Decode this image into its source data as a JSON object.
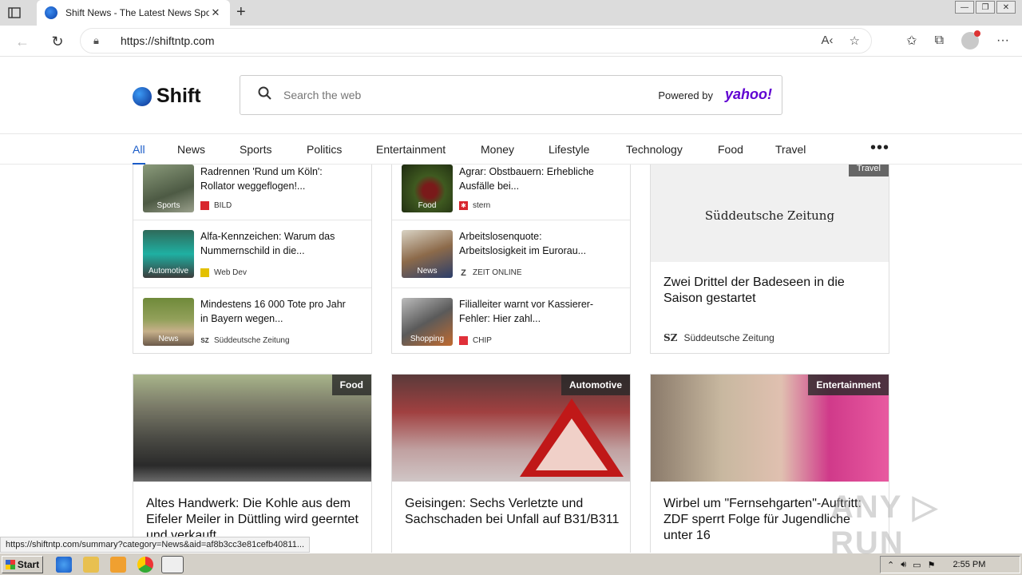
{
  "browser": {
    "tab_title": "Shift News - The Latest News Spo",
    "tab_close": "✕",
    "new_tab": "+",
    "url": "https://shiftntp.com",
    "window_buttons": [
      "—",
      "❐",
      "✕"
    ]
  },
  "site": {
    "logo": "Shift",
    "search_placeholder": "Search the web",
    "powered_by": "Powered by",
    "yahoo": "yahoo!"
  },
  "nav": {
    "items": [
      "All",
      "News",
      "Sports",
      "Politics",
      "Entertainment",
      "Money",
      "Lifestyle",
      "Technology",
      "Food",
      "Travel"
    ],
    "more": "•••"
  },
  "lists": [
    [
      {
        "title": "Radrennen 'Rund um Köln': Rollator weggeflogen!...",
        "category": "Sports",
        "source": "BILD",
        "source_color": "#d8262d",
        "thumb": "#6b7b62"
      },
      {
        "title": "Alfa-Kennzeichen: Warum das Nummernschild in die...",
        "category": "Automotive",
        "source": "Web Dev",
        "source_color": "#e3c000",
        "thumb": "#2aa39a"
      },
      {
        "title": "Mindestens 16 000 Tote pro Jahr in Bayern wegen...",
        "category": "News",
        "source": "Süddeutsche Zeitung",
        "source_color": "#333",
        "thumb": "#7a8b4a"
      }
    ],
    [
      {
        "title": "Agrar: Obstbauern: Erhebliche Ausfälle bei...",
        "category": "Food",
        "source": "stern",
        "source_color": "#d8262d",
        "thumb": "#4c5a2a"
      },
      {
        "title": "Arbeitslosenquote: Arbeitslosigkeit im Eurorau...",
        "category": "News",
        "source": "ZEIT ONLINE",
        "source_color": "#444",
        "thumb": "#8c6a4a"
      },
      {
        "title": "Filialleiter warnt vor Kassierer-Fehler: Hier zahl...",
        "category": "Shopping",
        "source": "CHIP",
        "source_color": "#e0303a",
        "thumb": "#5a5a5a"
      }
    ]
  ],
  "feature": {
    "tag": "Travel",
    "publisher_logo": "Süddeutsche Zeitung",
    "title": "Zwei Drittel der Badeseen in die Saison gestartet",
    "source": "Süddeutsche Zeitung",
    "source_mark": "SZ"
  },
  "cards": [
    {
      "tag": "Food",
      "title": "Altes Handwerk: Die Kohle aus dem Eifeler Meiler in Düttling wird geerntet und verkauft"
    },
    {
      "tag": "Automotive",
      "title": "Geisingen: Sechs Verletzte und Sachschaden bei Unfall auf B31/B311"
    },
    {
      "tag": "Entertainment",
      "title": "Wirbel um \"Fernsehgarten\"-Auftritt: ZDF sperrt Folge für Jugendliche unter 16"
    }
  ],
  "status_url": "https://shiftntp.com/summary?category=News&aid=af8b3cc3e81cefb40811...",
  "watermark": "ANY ▷ RUN",
  "taskbar": {
    "start": "Start",
    "time": "2:55 PM"
  }
}
